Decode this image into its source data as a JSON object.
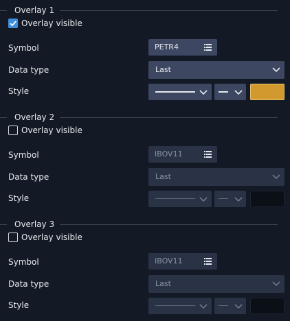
{
  "check_mark_color": "#ffffff",
  "icons": {
    "list": "list-icon",
    "chevron": "chevron-down-icon",
    "check": "check-icon"
  },
  "overlays": [
    {
      "title": "Overlay 1",
      "visible": true,
      "visible_label": "Overlay visible",
      "symbol_label": "Symbol",
      "symbol": "PETR4",
      "data_type_label": "Data type",
      "data_type": "Last",
      "style_label": "Style",
      "color": "#d29a2e"
    },
    {
      "title": "Overlay 2",
      "visible": false,
      "visible_label": "Overlay visible",
      "symbol_label": "Symbol",
      "symbol": "IBOV11",
      "data_type_label": "Data type",
      "data_type": "Last",
      "style_label": "Style",
      "color": "#0b0f16"
    },
    {
      "title": "Overlay 3",
      "visible": false,
      "visible_label": "Overlay visible",
      "symbol_label": "Symbol",
      "symbol": "IBOV11",
      "data_type_label": "Data type",
      "data_type": "Last",
      "style_label": "Style",
      "color": "#0b0f16"
    }
  ]
}
